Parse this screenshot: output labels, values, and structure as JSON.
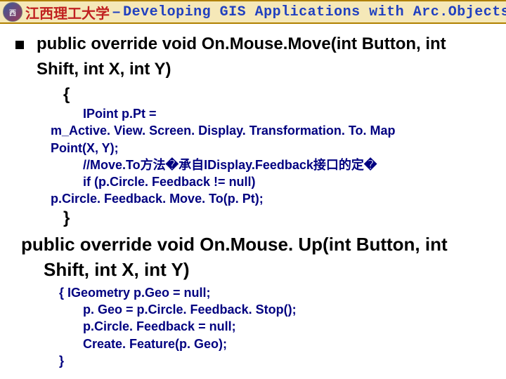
{
  "header": {
    "logo_letter": "西",
    "university": "江西理工大学",
    "dash": "–",
    "course_title": "Developing GIS Applications with Arc.Objects using C#. NE"
  },
  "code": {
    "m1_sig_a": "public override void On.Mouse.Move(int Button, int",
    "m1_sig_b": "Shift, int X, int Y)",
    "m1_open": "{",
    "m1_l1a": "IPoint p.Pt =",
    "m1_l1b": "m_Active. View. Screen. Display. Transformation. To. Map",
    "m1_l1c": "Point(X, Y);",
    "m1_l2": "//Move.To方法�承自IDisplay.Feedback接口的定�",
    "m1_l3a": "if (p.Circle. Feedback != null)",
    "m1_l3b": "p.Circle. Feedback. Move. To(p. Pt);",
    "m1_close": "}",
    "m2_sig_a": "public override void On.Mouse. Up(int Button, int",
    "m2_sig_b": "Shift, int X, int Y)",
    "m2_open_l1": "{   IGeometry p.Geo = null;",
    "m2_l2": "p. Geo = p.Circle. Feedback. Stop();",
    "m2_l3": "p.Circle. Feedback = null;",
    "m2_l4": "Create. Feature(p. Geo);",
    "m2_close": "}"
  }
}
